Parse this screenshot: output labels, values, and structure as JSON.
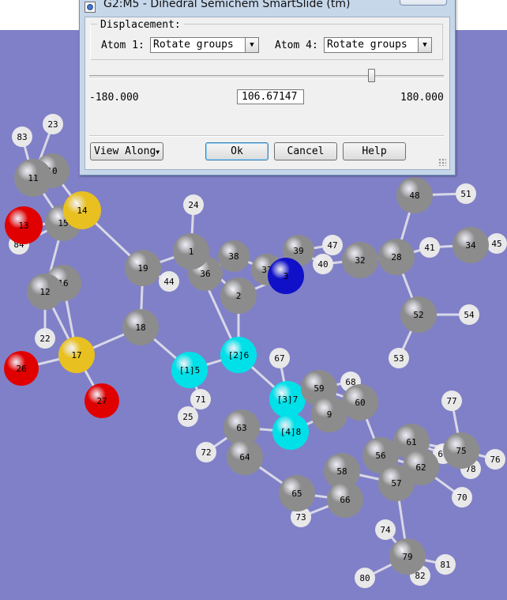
{
  "dialog": {
    "title": "G2:M5 - Dihedral Semichem SmartSlide (tm)",
    "close_glyph": "✕",
    "displacement_label": "Displacement:",
    "atom1_label": "Atom 1:",
    "atom1_value": "Rotate groups",
    "atom4_label": "Atom 4:",
    "atom4_value": "Rotate groups",
    "min_label": "-180.000",
    "max_label": "180.000",
    "current_value": "106.67147",
    "slider_fraction": 0.796,
    "view_along_label": "View Along",
    "ok_label": "Ok",
    "cancel_label": "Cancel",
    "help_label": "Help"
  },
  "colors": {
    "background": "#8080c8",
    "carbon": "#8c8c8c",
    "hydrogen": "#e8e8e8",
    "oxygen": "#e00000",
    "sulfur": "#e8c020",
    "nitrogen": "#1010c8",
    "selected": "#00e0e8"
  },
  "atoms": [
    {
      "id": "83",
      "el": "H"
    },
    {
      "id": "23",
      "el": "H"
    },
    {
      "id": "11",
      "el": "C"
    },
    {
      "id": "10",
      "el": "C"
    },
    {
      "id": "14",
      "el": "S"
    },
    {
      "id": "13",
      "el": "O"
    },
    {
      "id": "15",
      "el": "C"
    },
    {
      "id": "84",
      "el": "H"
    },
    {
      "id": "16",
      "el": "C"
    },
    {
      "id": "12",
      "el": "C"
    },
    {
      "id": "22",
      "el": "H"
    },
    {
      "id": "17",
      "el": "S"
    },
    {
      "id": "26",
      "el": "O"
    },
    {
      "id": "27",
      "el": "O"
    },
    {
      "id": "24",
      "el": "H"
    },
    {
      "id": "1",
      "el": "C"
    },
    {
      "id": "19",
      "el": "C"
    },
    {
      "id": "44",
      "el": "H"
    },
    {
      "id": "36",
      "el": "C"
    },
    {
      "id": "38",
      "el": "C"
    },
    {
      "id": "37",
      "el": "C"
    },
    {
      "id": "2",
      "el": "C"
    },
    {
      "id": "3",
      "el": "N"
    },
    {
      "id": "39",
      "el": "C"
    },
    {
      "id": "40",
      "el": "H"
    },
    {
      "id": "47",
      "el": "H"
    },
    {
      "id": "32",
      "el": "C"
    },
    {
      "id": "28",
      "el": "C"
    },
    {
      "id": "48",
      "el": "C"
    },
    {
      "id": "51",
      "el": "H"
    },
    {
      "id": "41",
      "el": "H"
    },
    {
      "id": "34",
      "el": "C"
    },
    {
      "id": "45",
      "el": "H"
    },
    {
      "id": "52",
      "el": "C"
    },
    {
      "id": "54",
      "el": "H"
    },
    {
      "id": "53",
      "el": "H"
    },
    {
      "id": "18",
      "el": "C"
    },
    {
      "id": "[1]5",
      "el": "sel"
    },
    {
      "id": "[2]6",
      "el": "sel"
    },
    {
      "id": "67",
      "el": "H"
    },
    {
      "id": "[3]7",
      "el": "sel"
    },
    {
      "id": "[4]8",
      "el": "sel"
    },
    {
      "id": "71",
      "el": "H"
    },
    {
      "id": "25",
      "el": "H"
    },
    {
      "id": "63",
      "el": "C"
    },
    {
      "id": "72",
      "el": "H"
    },
    {
      "id": "64",
      "el": "C"
    },
    {
      "id": "59",
      "el": "C"
    },
    {
      "id": "68",
      "el": "H"
    },
    {
      "id": "60",
      "el": "C"
    },
    {
      "id": "9",
      "el": "C"
    },
    {
      "id": "77",
      "el": "H"
    },
    {
      "id": "61",
      "el": "C"
    },
    {
      "id": "56",
      "el": "C"
    },
    {
      "id": "69",
      "el": "H"
    },
    {
      "id": "75",
      "el": "C"
    },
    {
      "id": "76",
      "el": "H"
    },
    {
      "id": "78",
      "el": "H"
    },
    {
      "id": "62",
      "el": "C"
    },
    {
      "id": "58",
      "el": "C"
    },
    {
      "id": "57",
      "el": "C"
    },
    {
      "id": "70",
      "el": "H"
    },
    {
      "id": "65",
      "el": "C"
    },
    {
      "id": "66",
      "el": "C"
    },
    {
      "id": "73",
      "el": "H"
    },
    {
      "id": "74",
      "el": "H"
    },
    {
      "id": "79",
      "el": "C"
    },
    {
      "id": "81",
      "el": "H"
    },
    {
      "id": "80",
      "el": "H"
    },
    {
      "id": "82",
      "el": "H"
    }
  ]
}
